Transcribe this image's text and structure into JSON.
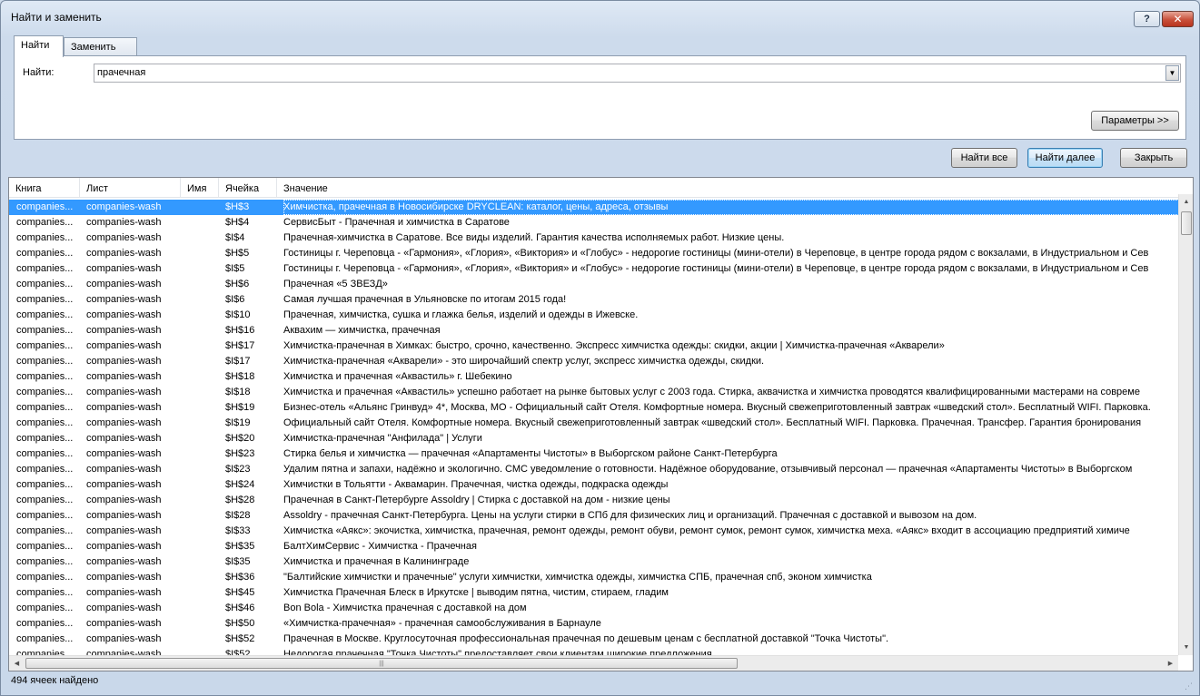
{
  "window": {
    "title": "Найти и заменить",
    "help_label": "?",
    "close_label": "✕"
  },
  "tabs": [
    {
      "label": "Найти",
      "active": true
    },
    {
      "label": "Заменить",
      "active": false
    }
  ],
  "find": {
    "label": "Найти:",
    "value": "прачечная",
    "dropdown_icon": "chevron-down-icon"
  },
  "buttons": {
    "options": "Параметры >>",
    "find_all": "Найти все",
    "find_next": "Найти далее",
    "close": "Закрыть"
  },
  "results": {
    "columns": [
      "Книга",
      "Лист",
      "Имя",
      "Ячейка",
      "Значение"
    ],
    "selected_color": "#3399ff",
    "rows": [
      {
        "book": "companies...",
        "sheet": "companies-wash",
        "name": "",
        "cell": "$H$3",
        "value": "Химчистка, прачечная в Новосибирске DRYCLEAN: каталог, цены, адреса, отзывы"
      },
      {
        "book": "companies...",
        "sheet": "companies-wash",
        "name": "",
        "cell": "$H$4",
        "value": "СервисБыт - Прачечная и химчистка в Саратове"
      },
      {
        "book": "companies...",
        "sheet": "companies-wash",
        "name": "",
        "cell": "$I$4",
        "value": "Прачечная-химчистка в Саратове. Все виды изделий. Гарантия качества исполняемых работ. Низкие цены."
      },
      {
        "book": "companies...",
        "sheet": "companies-wash",
        "name": "",
        "cell": "$H$5",
        "value": "Гостиницы г. Череповца - «Гармония», «Глория», «Виктория» и «Глобус» - недорогие гостиницы (мини-отели) в Череповце, в центре города рядом с вокзалами, в Индустриальном и Сев"
      },
      {
        "book": "companies...",
        "sheet": "companies-wash",
        "name": "",
        "cell": "$I$5",
        "value": "Гостиницы г. Череповца - «Гармония», «Глория», «Виктория» и «Глобус» - недорогие гостиницы (мини-отели) в Череповце, в центре города рядом с вокзалами, в Индустриальном и Сев"
      },
      {
        "book": "companies...",
        "sheet": "companies-wash",
        "name": "",
        "cell": "$H$6",
        "value": "Прачечная «5 ЗВЕЗД»"
      },
      {
        "book": "companies...",
        "sheet": "companies-wash",
        "name": "",
        "cell": "$I$6",
        "value": "Самая лучшая прачечная в Ульяновске по итогам 2015 года!"
      },
      {
        "book": "companies...",
        "sheet": "companies-wash",
        "name": "",
        "cell": "$I$10",
        "value": "Прачечная, химчистка, сушка и глажка белья, изделий и одежды в Ижевске."
      },
      {
        "book": "companies...",
        "sheet": "companies-wash",
        "name": "",
        "cell": "$H$16",
        "value": "Аквахим — химчистка, прачечная"
      },
      {
        "book": "companies...",
        "sheet": "companies-wash",
        "name": "",
        "cell": "$H$17",
        "value": "Химчистка-прачечная в Химках: быстро, срочно, качественно. Экспресс химчистка одежды: скидки, акции | Химчистка-прачечная «Акварели»"
      },
      {
        "book": "companies...",
        "sheet": "companies-wash",
        "name": "",
        "cell": "$I$17",
        "value": "Химчистка-прачечная «Акварели» - это широчайший спектр услуг, экспресс химчистка одежды, скидки."
      },
      {
        "book": "companies...",
        "sheet": "companies-wash",
        "name": "",
        "cell": "$H$18",
        "value": "Химчистка и прачечная «Аквастиль» г. Шебекино"
      },
      {
        "book": "companies...",
        "sheet": "companies-wash",
        "name": "",
        "cell": "$I$18",
        "value": "Химчистка и прачечная «Аквастиль» успешно работает на рынке бытовых услуг с 2003 года. Стирка, аквачистка и химчистка проводятся квалифицированными мастерами на совреме"
      },
      {
        "book": "companies...",
        "sheet": "companies-wash",
        "name": "",
        "cell": "$H$19",
        "value": "Бизнес-отель «Альянс Гринвуд» 4*, Москва, МО - Официальный сайт Отеля. Комфортные номера. Вкусный свежеприготовленный завтрак «шведский стол». Бесплатный WIFI. Парковка."
      },
      {
        "book": "companies...",
        "sheet": "companies-wash",
        "name": "",
        "cell": "$I$19",
        "value": "Официальный сайт Отеля. Комфортные номера. Вкусный свежеприготовленный завтрак «шведский стол». Бесплатный WIFI. Парковка. Прачечная. Трансфер. Гарантия бронирования"
      },
      {
        "book": "companies...",
        "sheet": "companies-wash",
        "name": "",
        "cell": "$H$20",
        "value": "Химчистка-прачечная \"Анфилада\" | Услуги"
      },
      {
        "book": "companies...",
        "sheet": "companies-wash",
        "name": "",
        "cell": "$H$23",
        "value": "Стирка белья и химчистка — прачечная «Апартаменты Чистоты» в Выборгском районе Санкт-Петербурга"
      },
      {
        "book": "companies...",
        "sheet": "companies-wash",
        "name": "",
        "cell": "$I$23",
        "value": "Удалим пятна и запахи, надёжно и экологично. СМС уведомление о готовности. Надёжное оборудование, отзывчивый персонал — прачечная «Апартаменты Чистоты» в Выборгском"
      },
      {
        "book": "companies...",
        "sheet": "companies-wash",
        "name": "",
        "cell": "$H$24",
        "value": "Химчистки в Тольятти - Аквамарин. Прачечная, чистка одежды, подкраска одежды"
      },
      {
        "book": "companies...",
        "sheet": "companies-wash",
        "name": "",
        "cell": "$H$28",
        "value": "Прачечная в Санкт-Петербурге Assoldry | Стирка с доставкой на дом - низкие цены"
      },
      {
        "book": "companies...",
        "sheet": "companies-wash",
        "name": "",
        "cell": "$I$28",
        "value": "Assoldry - прачечная Санкт-Петербурга. Цены на услуги стирки в СПб для физических лиц и организаций. Прачечная с доставкой и вывозом на дом."
      },
      {
        "book": "companies...",
        "sheet": "companies-wash",
        "name": "",
        "cell": "$I$33",
        "value": "Химчистка «Аякс»: экочистка, химчистка, прачечная, ремонт одежды, ремонт обуви, ремонт сумок, ремонт сумок, химчистка меха. «Аякс» входит в ассоциацию предприятий химиче"
      },
      {
        "book": "companies...",
        "sheet": "companies-wash",
        "name": "",
        "cell": "$H$35",
        "value": "БалтХимСервис - Химчистка - Прачечная"
      },
      {
        "book": "companies...",
        "sheet": "companies-wash",
        "name": "",
        "cell": "$I$35",
        "value": "Химчистка и прачечная в Калининграде"
      },
      {
        "book": "companies...",
        "sheet": "companies-wash",
        "name": "",
        "cell": "$H$36",
        "value": "\"Балтийские химчистки и прачечные\" услуги химчистки, химчистка одежды, химчистка СПБ, прачечная спб, эконом химчистка"
      },
      {
        "book": "companies...",
        "sheet": "companies-wash",
        "name": "",
        "cell": "$H$45",
        "value": "Химчистка Прачечная Блеск в Иркутске | выводим пятна, чистим, стираем, гладим"
      },
      {
        "book": "companies...",
        "sheet": "companies-wash",
        "name": "",
        "cell": "$H$46",
        "value": "Bon Bola - Химчистка прачечная с доставкой на дом"
      },
      {
        "book": "companies...",
        "sheet": "companies-wash",
        "name": "",
        "cell": "$H$50",
        "value": "«Химчистка-прачечная» - прачечная самообслуживания в Барнауле"
      },
      {
        "book": "companies...",
        "sheet": "companies-wash",
        "name": "",
        "cell": "$H$52",
        "value": "Прачечная в Москве. Круглосуточная профессиональная прачечная по дешевым ценам с бесплатной доставкой \"Точка Чистоты\"."
      },
      {
        "book": "companies...",
        "sheet": "companies-wash",
        "name": "",
        "cell": "$I$52",
        "value": "Недорогая прачечная \"Точка Чистоты\" предоставляет свои клиентам широкие предложения"
      }
    ]
  },
  "status": {
    "text": "494 ячеек найдено"
  }
}
